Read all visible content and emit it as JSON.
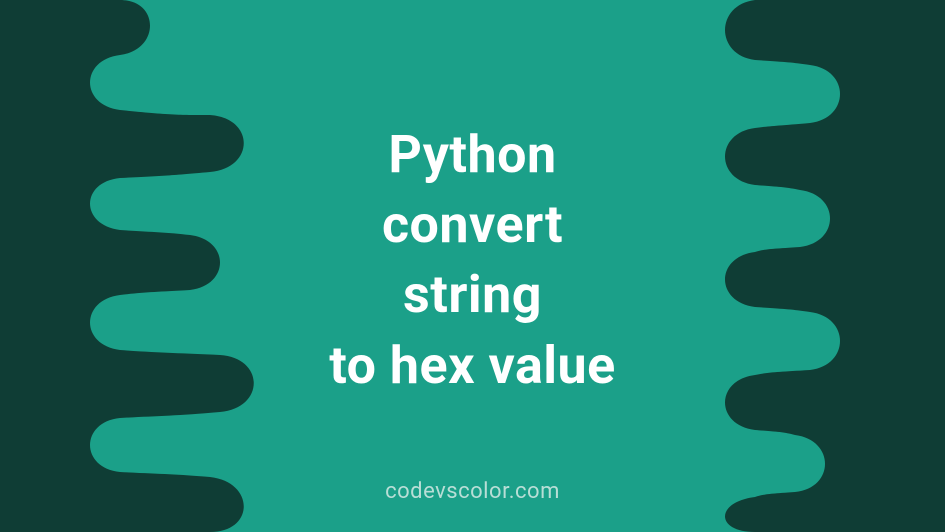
{
  "colors": {
    "background": "#1ba089",
    "blob": "#0f3d35",
    "text": "#ffffff",
    "watermark": "#b8ded6"
  },
  "title": {
    "line1": "Python",
    "line2": "convert",
    "line3": "string",
    "line4": "to hex value"
  },
  "watermark": "codevscolor.com"
}
